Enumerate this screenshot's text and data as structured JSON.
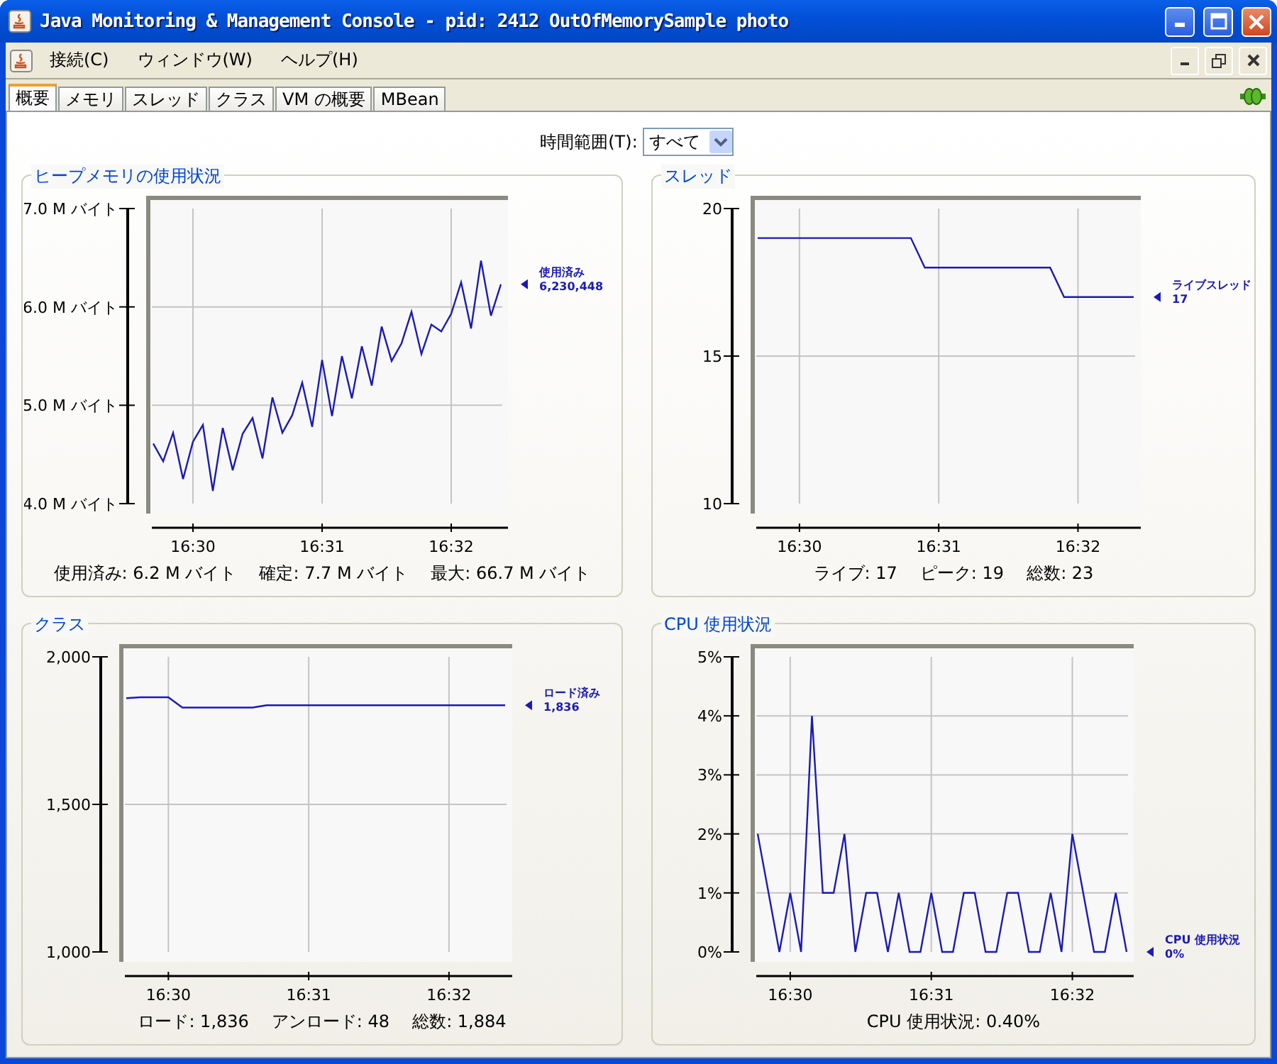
{
  "window": {
    "title": "Java Monitoring & Management Console - pid: 2412 OutOfMemorySample photo"
  },
  "menu": [
    "接続(C)",
    "ウィンドウ(W)",
    "ヘルプ(H)"
  ],
  "tabs": [
    {
      "label": "概要",
      "selected": true
    },
    {
      "label": "メモリ",
      "selected": false
    },
    {
      "label": "スレッド",
      "selected": false
    },
    {
      "label": "クラス",
      "selected": false
    },
    {
      "label": "VM の概要",
      "selected": false
    },
    {
      "label": "MBean",
      "selected": false
    }
  ],
  "time_range": {
    "label": "時間範囲(T):",
    "value": "すべて"
  },
  "panels": [
    {
      "title": "ヒープメモリの使用状況",
      "legend_value": "6,230,448",
      "summary": [
        "使用済み: 6.2 M バイト",
        "確定: 7.7 M バイト",
        "最大: 66.7 M バイト"
      ],
      "chart_data": {
        "type": "line",
        "grid": true,
        "ylim": [
          4,
          7
        ],
        "yticks": [
          {
            "value": 4,
            "label": "4.0 M バイト"
          },
          {
            "value": 5,
            "label": "5.0 M バイト"
          },
          {
            "value": 6,
            "label": "6.0 M バイト"
          },
          {
            "value": 7,
            "label": "7.0 M バイト"
          }
        ],
        "categories": [
          null,
          null,
          null,
          null,
          "16:30",
          null,
          null,
          null,
          null,
          null,
          null,
          null,
          null,
          null,
          null,
          null,
          null,
          "16:31",
          null,
          null,
          null,
          null,
          null,
          null,
          null,
          null,
          null,
          null,
          null,
          null,
          "16:32",
          null,
          null,
          null,
          null,
          null
        ],
        "series": [
          {
            "name": "使用済み",
            "color": "#1a1ab8",
            "values": [
              4.61,
              4.43,
              4.72,
              4.25,
              4.63,
              4.8,
              4.13,
              4.77,
              4.34,
              4.71,
              4.87,
              4.46,
              5.08,
              4.72,
              4.9,
              5.23,
              4.78,
              5.46,
              4.89,
              5.5,
              5.07,
              5.6,
              5.2,
              5.8,
              5.45,
              5.63,
              5.95,
              5.52,
              5.82,
              5.75,
              5.93,
              6.25,
              5.78,
              6.47,
              5.91,
              6.23
            ]
          }
        ]
      }
    },
    {
      "title": "スレッド",
      "legend_value": "17",
      "summary": [
        "ライブ: 17",
        "ピーク: 19",
        "総数: 23"
      ],
      "chart_data": {
        "type": "line",
        "grid": true,
        "ylim": [
          10,
          20
        ],
        "yticks": [
          {
            "value": 10,
            "label": "10"
          },
          {
            "value": 15,
            "label": "15"
          },
          {
            "value": 20,
            "label": "20"
          }
        ],
        "categories": [
          null,
          null,
          null,
          "16:30",
          null,
          null,
          null,
          null,
          null,
          null,
          null,
          null,
          null,
          "16:31",
          null,
          null,
          null,
          null,
          null,
          null,
          null,
          null,
          null,
          "16:32",
          null,
          null,
          null,
          null
        ],
        "series": [
          {
            "name": "ライブスレッド",
            "color": "#1a1ab8",
            "values": [
              19,
              19,
              19,
              19,
              19,
              19,
              19,
              19,
              19,
              19,
              19,
              19,
              18,
              18,
              18,
              18,
              18,
              18,
              18,
              18,
              18,
              18,
              17,
              17,
              17,
              17,
              17,
              17
            ]
          }
        ]
      }
    },
    {
      "title": "クラス",
      "legend_value": "1,836",
      "summary": [
        "ロード: 1,836",
        "アンロード: 48",
        "総数: 1,884"
      ],
      "chart_data": {
        "type": "line",
        "grid": true,
        "ylim": [
          1000,
          2000
        ],
        "yticks": [
          {
            "value": 1000,
            "label": "1,000"
          },
          {
            "value": 1500,
            "label": "1,500"
          },
          {
            "value": 2000,
            "label": "2,000"
          }
        ],
        "categories": [
          null,
          null,
          null,
          "16:30",
          null,
          null,
          null,
          null,
          null,
          null,
          null,
          null,
          null,
          "16:31",
          null,
          null,
          null,
          null,
          null,
          null,
          null,
          null,
          null,
          "16:32",
          null,
          null,
          null,
          null
        ],
        "series": [
          {
            "name": "ロード済み",
            "color": "#1a1ab8",
            "values": [
              1860,
              1863,
              1863,
              1863,
              1828,
              1828,
              1828,
              1828,
              1828,
              1828,
              1836,
              1836,
              1836,
              1836,
              1836,
              1836,
              1836,
              1836,
              1836,
              1836,
              1836,
              1836,
              1836,
              1836,
              1836,
              1836,
              1836,
              1836
            ]
          }
        ]
      }
    },
    {
      "title": "CPU 使用状況",
      "legend_value": "0%",
      "summary": [
        "CPU 使用状況: 0.40%"
      ],
      "chart_data": {
        "type": "line",
        "grid": true,
        "ylim": [
          0,
          5
        ],
        "yticks": [
          {
            "value": 0,
            "label": "0%"
          },
          {
            "value": 1,
            "label": "1%"
          },
          {
            "value": 2,
            "label": "2%"
          },
          {
            "value": 3,
            "label": "3%"
          },
          {
            "value": 4,
            "label": "4%"
          },
          {
            "value": 5,
            "label": "5%"
          }
        ],
        "categories": [
          null,
          null,
          null,
          "16:30",
          null,
          null,
          null,
          null,
          null,
          null,
          null,
          null,
          null,
          null,
          null,
          null,
          "16:31",
          null,
          null,
          null,
          null,
          null,
          null,
          null,
          null,
          null,
          null,
          null,
          null,
          "16:32",
          null,
          null,
          null,
          null,
          null
        ],
        "series": [
          {
            "name": "CPU 使用状況",
            "color": "#1a1ab8",
            "values": [
              2,
              1,
              0,
              1,
              0,
              4,
              1,
              1,
              2,
              0,
              1,
              1,
              0,
              1,
              0,
              0,
              1,
              0,
              0,
              1,
              1,
              0,
              0,
              1,
              1,
              0,
              0,
              1,
              0,
              2,
              1,
              0,
              0,
              1,
              0
            ]
          }
        ]
      }
    }
  ]
}
